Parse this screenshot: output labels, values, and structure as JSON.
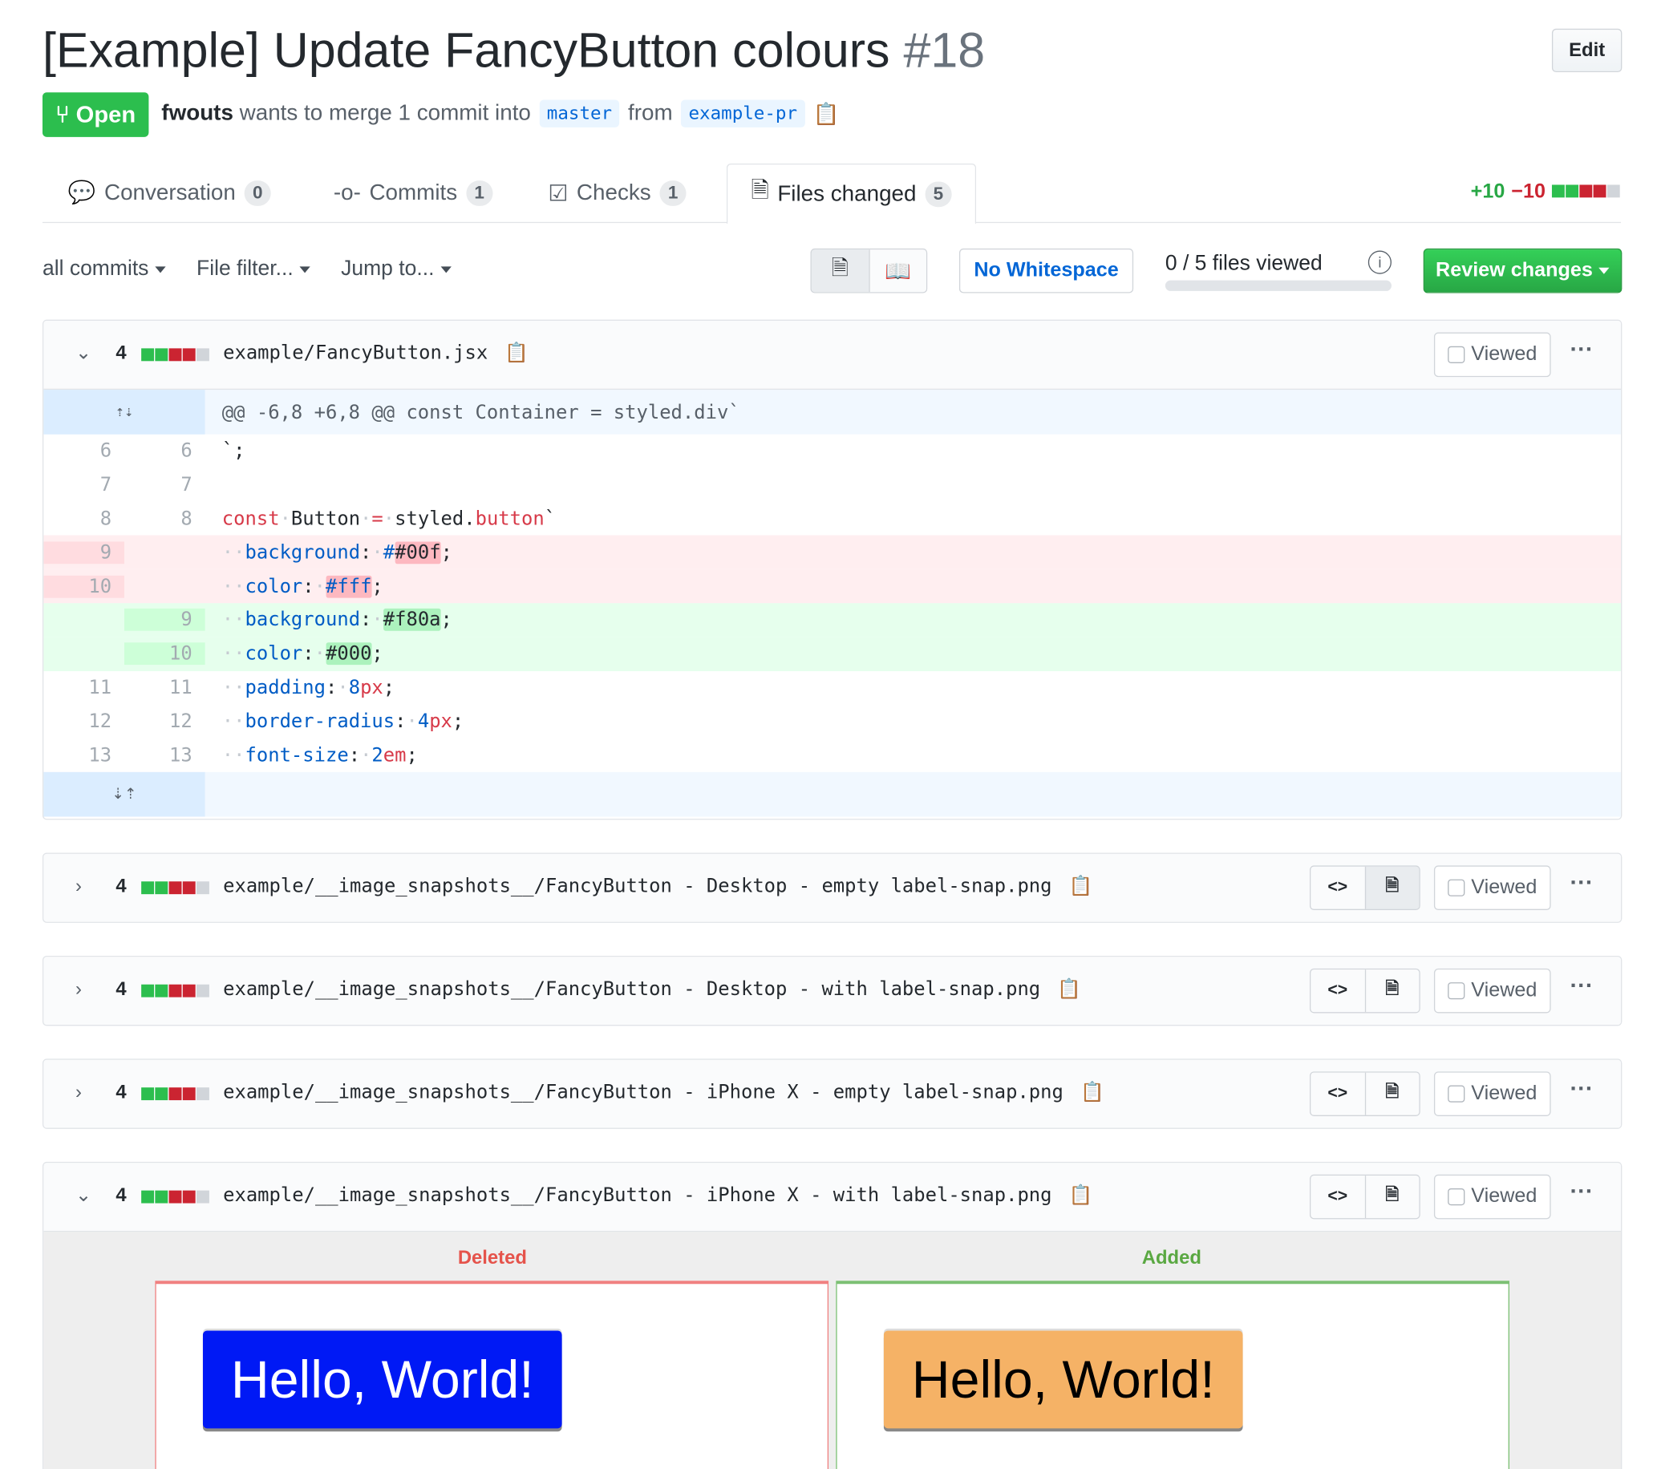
{
  "header": {
    "title": "[Example] Update FancyButton colours",
    "number": "#18",
    "edit_label": "Edit",
    "state": "Open",
    "author": "fwouts",
    "merge_text": "wants to merge 1 commit into",
    "base": "master",
    "from_text": "from",
    "head": "example-pr"
  },
  "tabs": [
    {
      "label": "Conversation",
      "count": "0"
    },
    {
      "label": "Commits",
      "count": "1"
    },
    {
      "label": "Checks",
      "count": "1"
    },
    {
      "label": "Files changed",
      "count": "5"
    }
  ],
  "diffstat": {
    "additions": "+10",
    "deletions": "−10"
  },
  "toolbar": {
    "commits": "all commits",
    "filter": "File filter...",
    "jump": "Jump to...",
    "whitespace": "No Whitespace",
    "files_viewed": "0 / 5 files viewed",
    "files_viewed_fraction": 0,
    "review": "Review changes"
  },
  "files": [
    {
      "changes": "4",
      "name": "example/FancyButton.jsx",
      "expanded": true
    },
    {
      "changes": "4",
      "name": "example/__image_snapshots__/FancyButton - Desktop - empty label-snap.png"
    },
    {
      "changes": "4",
      "name": "example/__image_snapshots__/FancyButton - Desktop - with label-snap.png"
    },
    {
      "changes": "4",
      "name": "example/__image_snapshots__/FancyButton - iPhone X - empty label-snap.png"
    },
    {
      "changes": "4",
      "name": "example/__image_snapshots__/FancyButton - iPhone X - with label-snap.png",
      "expanded": true
    }
  ],
  "viewed_label": "Viewed",
  "hunk": "@@ -6,8 +6,8 @@ const Container = styled.div`",
  "lines": [
    {
      "old": "6",
      "new": "6"
    },
    {
      "old": "7",
      "new": "7"
    },
    {
      "old": "8",
      "new": "8"
    },
    {
      "old": "9",
      "new": ""
    },
    {
      "old": "10",
      "new": ""
    },
    {
      "old": "",
      "new": "9"
    },
    {
      "old": "",
      "new": "10"
    },
    {
      "old": "11",
      "new": "11"
    },
    {
      "old": "12",
      "new": "12"
    },
    {
      "old": "13",
      "new": "13"
    }
  ],
  "code": {
    "l6": "`;",
    "const": "const",
    "button_name": "Button",
    "eq": "=",
    "styled": "styled.",
    "button": "button",
    "bt": "`",
    "background": "background",
    "color": "color",
    "padding": "padding",
    "radius": "border-radius",
    "fontsize": "font-size",
    "v_00f": "#00f",
    "v_fff": "#fff",
    "v_f80a": "#f80a",
    "v_000": "#000",
    "v_8": "8",
    "v_4": "4",
    "v_2": "2",
    "px": "px",
    "em": "em"
  },
  "image_diff": {
    "deleted_label": "Deleted",
    "added_label": "Added",
    "button_text": "Hello, World!",
    "old_bg": "#0019f5",
    "old_fg": "#ffffff",
    "new_bg": "#f5b266",
    "new_fg": "#000000"
  }
}
